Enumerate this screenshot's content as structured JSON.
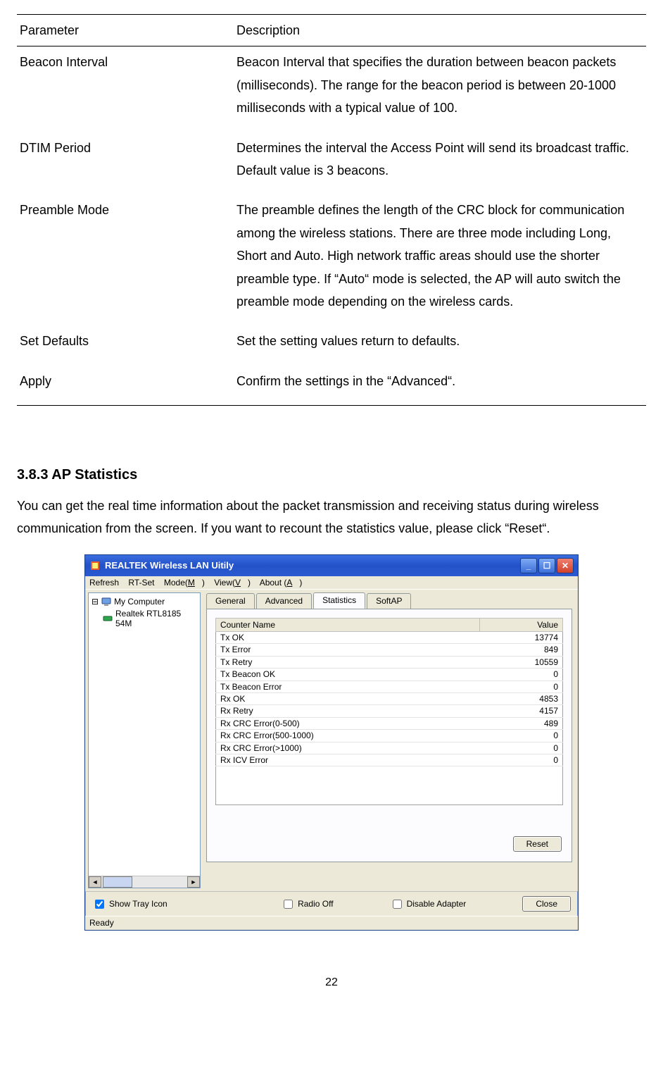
{
  "table": {
    "headers": {
      "param": "Parameter",
      "desc": "Description"
    },
    "rows": [
      {
        "param": "Beacon Interval",
        "desc": "Beacon Interval that specifies the duration between beacon packets (milliseconds). The range for the beacon period is between 20-1000 milliseconds with a typical value of 100."
      },
      {
        "param": "DTIM Period",
        "desc": "Determines the interval the Access Point will send its broadcast traffic. Default value is 3 beacons."
      },
      {
        "param": "Preamble Mode",
        "desc": "The preamble defines the length of the CRC block for communication among the wireless stations. There are three mode including Long, Short and Auto. High network traffic areas should use the shorter preamble type. If “Auto“ mode is selected, the AP will auto switch the preamble mode depending on the wireless cards."
      },
      {
        "param": "Set Defaults",
        "desc": "Set the setting values return to defaults."
      },
      {
        "param": "Apply",
        "desc": "Confirm the settings in the “Advanced“."
      }
    ]
  },
  "section": {
    "heading": "3.8.3    AP Statistics",
    "body": "You can get the real time information about the packet transmission and receiving status during wireless communication from the screen. If you want to recount the statistics value, please click “Reset“."
  },
  "window": {
    "title": "REALTEK Wireless LAN Uitily",
    "menu": {
      "refresh": "Refresh",
      "rtset": "RT-Set",
      "mode": "Mode(M)",
      "view": "View(V)",
      "about": "About (A)"
    },
    "tree": {
      "root": "My Computer",
      "node": "Realtek RTL8185 54M"
    },
    "tabs": {
      "general": "General",
      "advanced": "Advanced",
      "statistics": "Statistics",
      "softap": "SoftAP"
    },
    "stats": {
      "header_name": "Counter Name",
      "header_value": "Value",
      "rows": [
        {
          "name": "Tx OK",
          "value": "13774"
        },
        {
          "name": "Tx Error",
          "value": "849"
        },
        {
          "name": "Tx Retry",
          "value": "10559"
        },
        {
          "name": "Tx Beacon OK",
          "value": "0"
        },
        {
          "name": "Tx Beacon Error",
          "value": "0"
        },
        {
          "name": "Rx OK",
          "value": "4853"
        },
        {
          "name": "Rx Retry",
          "value": "4157"
        },
        {
          "name": "Rx CRC Error(0-500)",
          "value": "489"
        },
        {
          "name": "Rx CRC Error(500-1000)",
          "value": "0"
        },
        {
          "name": "Rx CRC Error(>1000)",
          "value": "0"
        },
        {
          "name": "Rx ICV Error",
          "value": "0"
        }
      ]
    },
    "buttons": {
      "reset": "Reset",
      "close": "Close"
    },
    "bottom": {
      "tray": "Show Tray Icon",
      "radio": "Radio Off",
      "disable": "Disable Adapter"
    },
    "status": "Ready"
  },
  "page_number": "22"
}
